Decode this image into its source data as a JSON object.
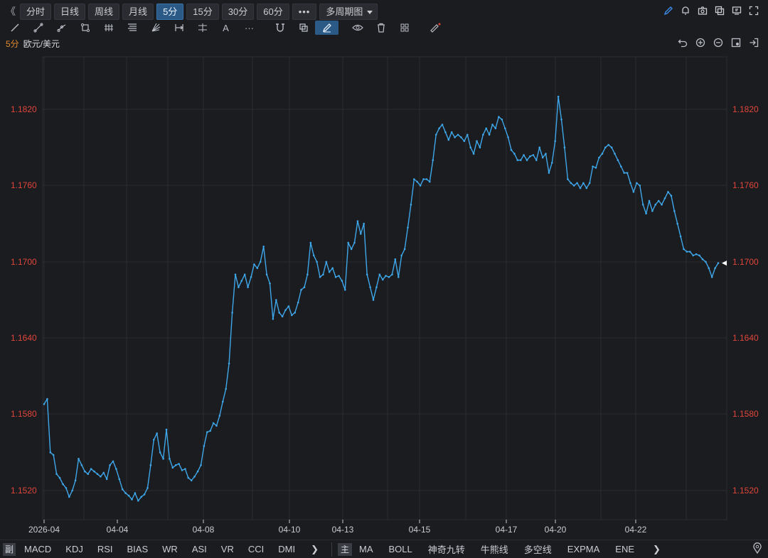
{
  "toolbar": {
    "collapse_label": "《",
    "periods": [
      {
        "label": "分时",
        "active": false
      },
      {
        "label": "日线",
        "active": false
      },
      {
        "label": "周线",
        "active": false
      },
      {
        "label": "月线",
        "active": false
      },
      {
        "label": "5分",
        "active": true
      },
      {
        "label": "15分",
        "active": false
      },
      {
        "label": "30分",
        "active": false
      },
      {
        "label": "60分",
        "active": false
      }
    ],
    "more_label": "•••",
    "multi_period_label": "多周期图",
    "right_icons": [
      "pen-icon",
      "alert-bell-icon",
      "camera-icon",
      "copy-icon",
      "screen-icon",
      "fullscreen-icon"
    ]
  },
  "drawing_tools": {
    "icons": [
      "line-icon",
      "ray-icon",
      "segment-icon",
      "rectangle-icon",
      "parallel-icon",
      "fibonacci-icon",
      "fan-icon",
      "range-icon",
      "measure-icon",
      "text-icon",
      "more-tools-icon",
      "magnet-icon",
      "layers-icon",
      "edit-icon",
      "eye-icon",
      "trash-icon",
      "grid-icon",
      "ruler-icon"
    ],
    "text_tool_label": "A",
    "more_label": "···",
    "selected": "edit-icon"
  },
  "instrument": {
    "period": "5分",
    "name": "欧元/美元",
    "right_icons": [
      "undo-icon",
      "zoom-in-icon",
      "zoom-out-icon",
      "settings-icon",
      "exit-icon"
    ]
  },
  "chart_data": {
    "type": "line",
    "y_ticks": [
      "1.1820",
      "1.1760",
      "1.1700",
      "1.1640",
      "1.1580",
      "1.1520"
    ],
    "x_ticks": [
      "2026-04",
      "04-04",
      "04-08",
      "04-10",
      "04-13",
      "04-15",
      "04-17",
      "04-20",
      "04-22"
    ],
    "ylim": [
      1.1495,
      1.186
    ],
    "last_price": 1.1699,
    "grid": true,
    "colors": {
      "line": "#3ea7ea",
      "tick": "#e0453a",
      "grid": "#2a2c31",
      "xaxis": "#c9ccd3"
    },
    "series": [
      {
        "values": [
          1.1588,
          1.1592,
          1.155,
          1.1548,
          1.1533,
          1.153,
          1.1525,
          1.1522,
          1.1515,
          1.152,
          1.1528,
          1.1545,
          1.154,
          1.1535,
          1.1533,
          1.1537,
          1.1535,
          1.1533,
          1.1531,
          1.1534,
          1.1529,
          1.154,
          1.1543,
          1.1537,
          1.1529,
          1.1521,
          1.1518,
          1.1516,
          1.1513,
          1.1518,
          1.1512,
          1.1515,
          1.1517,
          1.1522,
          1.154,
          1.156,
          1.1565,
          1.155,
          1.1545,
          1.1568,
          1.1545,
          1.1538,
          1.154,
          1.1541,
          1.1536,
          1.1537,
          1.153,
          1.1528,
          1.1531,
          1.1535,
          1.154,
          1.1555,
          1.1566,
          1.1567,
          1.1573,
          1.1571,
          1.1579,
          1.159,
          1.16,
          1.162,
          1.166,
          1.169,
          1.168,
          1.1685,
          1.169,
          1.168,
          1.1688,
          1.1698,
          1.1695,
          1.17,
          1.1712,
          1.169,
          1.1683,
          1.1655,
          1.167,
          1.166,
          1.1657,
          1.1662,
          1.1665,
          1.1658,
          1.166,
          1.1668,
          1.1678,
          1.168,
          1.169,
          1.1715,
          1.1705,
          1.17,
          1.1688,
          1.169,
          1.17,
          1.1692,
          1.1695,
          1.1688,
          1.1689,
          1.1685,
          1.1678,
          1.1715,
          1.171,
          1.1715,
          1.1732,
          1.1722,
          1.173,
          1.169,
          1.168,
          1.167,
          1.168,
          1.169,
          1.1686,
          1.1689,
          1.1688,
          1.169,
          1.1702,
          1.1688,
          1.1705,
          1.171,
          1.1727,
          1.1745,
          1.1765,
          1.1763,
          1.176,
          1.1765,
          1.1765,
          1.1763,
          1.178,
          1.18,
          1.1805,
          1.1808,
          1.1802,
          1.1796,
          1.1802,
          1.1798,
          1.18,
          1.1798,
          1.1795,
          1.18,
          1.179,
          1.1785,
          1.1795,
          1.179,
          1.18,
          1.1805,
          1.18,
          1.1808,
          1.1805,
          1.1814,
          1.1812,
          1.1805,
          1.1798,
          1.1788,
          1.1785,
          1.178,
          1.178,
          1.1784,
          1.178,
          1.1783,
          1.1784,
          1.178,
          1.179,
          1.1782,
          1.1785,
          1.177,
          1.1778,
          1.1795,
          1.183,
          1.1812,
          1.179,
          1.1765,
          1.1762,
          1.176,
          1.1762,
          1.1758,
          1.1762,
          1.1758,
          1.1762,
          1.1775,
          1.1774,
          1.1782,
          1.1785,
          1.179,
          1.1792,
          1.179,
          1.1785,
          1.178,
          1.1775,
          1.177,
          1.177,
          1.1762,
          1.1755,
          1.1762,
          1.176,
          1.1745,
          1.1738,
          1.1748,
          1.174,
          1.1745,
          1.1748,
          1.1745,
          1.175,
          1.1755,
          1.1752,
          1.174,
          1.173,
          1.172,
          1.171,
          1.1708,
          1.1708,
          1.1705,
          1.1706,
          1.1705,
          1.1702,
          1.17,
          1.1695,
          1.1688,
          1.1695,
          1.1699
        ]
      }
    ]
  },
  "bottom_bar": {
    "sub_label": "副",
    "sub_indicators": [
      "MACD",
      "KDJ",
      "RSI",
      "BIAS",
      "WR",
      "ASI",
      "VR",
      "CCI",
      "DMI"
    ],
    "main_label": "主",
    "main_indicators": [
      "MA",
      "BOLL",
      "神奇九转",
      "牛熊线",
      "多空线",
      "EXPMA",
      "ENE"
    ],
    "arrow": "❯",
    "location_icon": "location-pin-icon"
  }
}
